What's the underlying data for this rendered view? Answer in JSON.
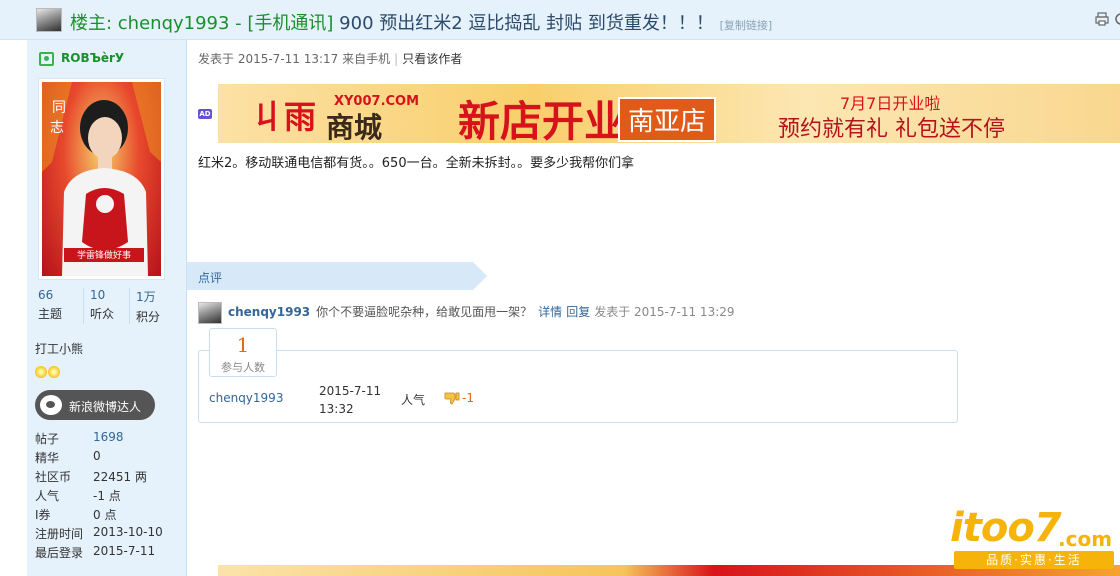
{
  "header": {
    "title_prefix": "楼主: chenqy1993 - [手机通讯]",
    "title_main": " 900 预出红米2 逗比捣乱 封贴 到货重发！！！",
    "copy_link": "[复制链接]"
  },
  "sidebar": {
    "username": "ROBЪèrУ",
    "stats": [
      {
        "value": "66",
        "label": "主题"
      },
      {
        "value": "10",
        "label": "听众"
      },
      {
        "value": "1万",
        "label": "积分"
      }
    ],
    "group": "打工小熊",
    "badge": "新浪微博达人",
    "info": [
      {
        "key": "帖子",
        "value": "1698"
      },
      {
        "key": "精华",
        "value": "0"
      },
      {
        "key": "社区币",
        "value": "22451 两"
      },
      {
        "key": "人气",
        "value": "-1 点"
      },
      {
        "key": "I券",
        "value": "0 点"
      },
      {
        "key": "注册时间",
        "value": "2013-10-10"
      },
      {
        "key": "最后登录",
        "value": "2015-7-11"
      }
    ]
  },
  "post": {
    "posted": "发表于 2015-7-11 13:17 来自手机",
    "author_only": "只看该作者",
    "ad_label": "AD",
    "banner": {
      "logo_glyph": "丩雨",
      "domain": "XY007.COM",
      "shop": "商城",
      "headline": "新店开业",
      "branch": "南亚店",
      "date": "7月7日开业啦",
      "slogan": "预约就有礼  礼包送不停"
    },
    "body": "红米2。移动联通电信都有货。。650一台。全新未拆封。。要多少我帮你们拿"
  },
  "comments": {
    "section_title": "点评",
    "items": [
      {
        "user": "chenqy1993",
        "text": "你个不要逼脸呢杂种，给敢见面甩一架？",
        "detail": "详情",
        "reply": "回复",
        "time": "发表于 2015-7-11 13:29"
      }
    ]
  },
  "rating": {
    "count": "1",
    "count_label": "参与人数",
    "user": "chenqy1993",
    "date_line1": "2015-7-11",
    "date_line2": "13:32",
    "field": "人气",
    "value": "-1"
  },
  "watermark": {
    "text": "itoo7",
    "com": ".com",
    "tagline": "品质·实惠·生活"
  },
  "colors": {
    "header_bg": "#e5f1fb",
    "link": "#336699",
    "green_name": "#1a8f2e",
    "accent_orange": "#e06a1a"
  }
}
